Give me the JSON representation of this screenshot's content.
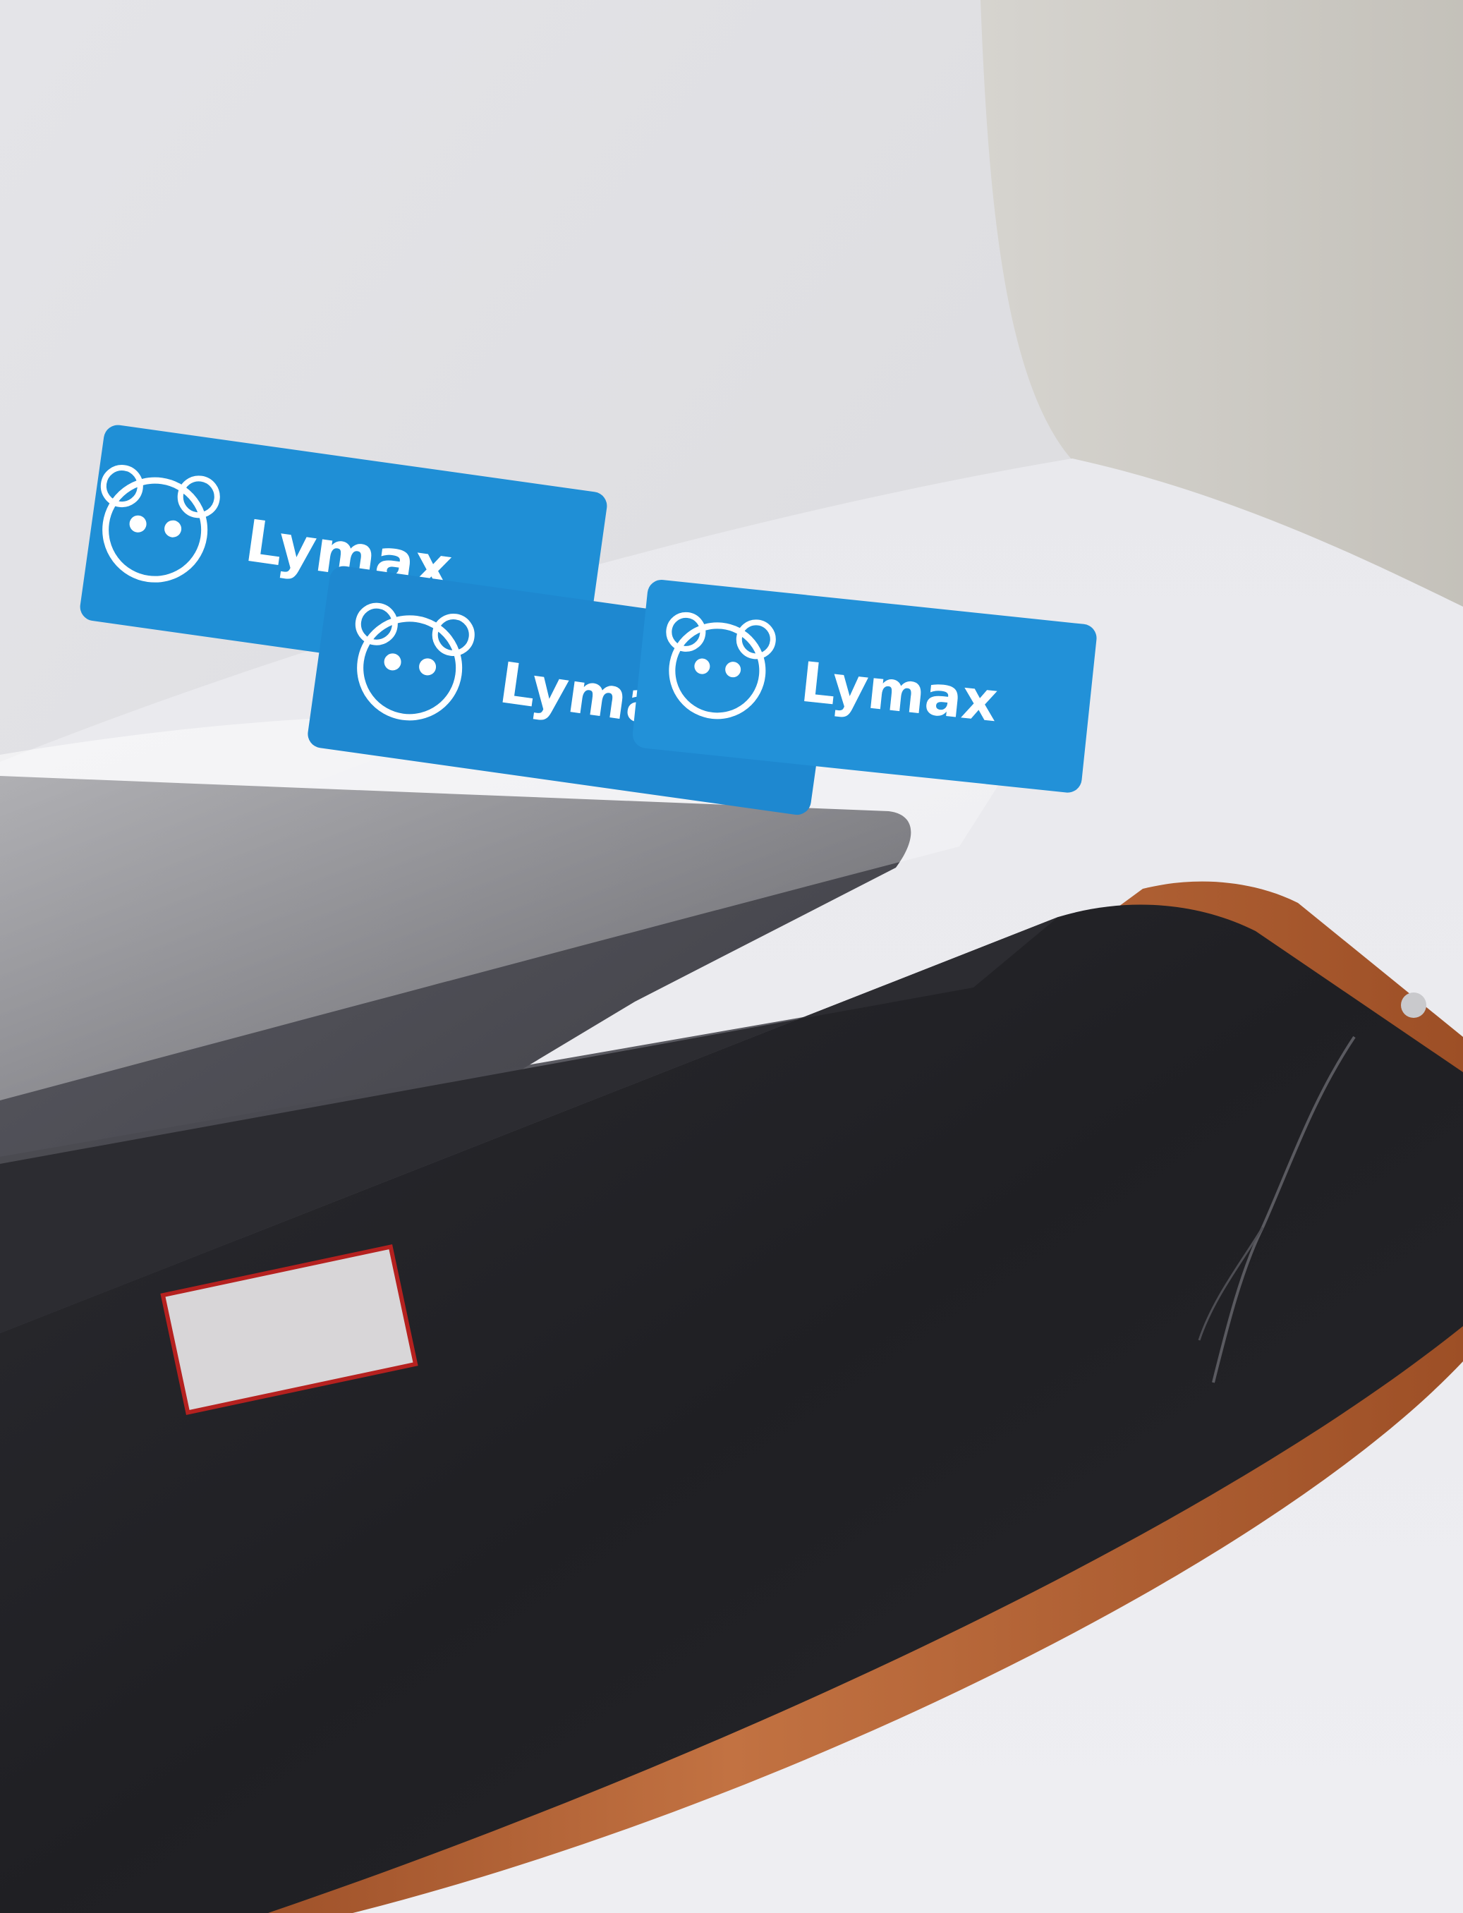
{
  "scene": {
    "subject": "Smartphone with cracked screen beside a screen-protector film with blue peel tabs",
    "colors": {
      "wall": "#dcdcdc",
      "wall_shadow": "#c9c6c0",
      "table": "#ebebef",
      "film_dark": "#3d3d44",
      "phone_screen": "#202024",
      "phone_case": "#b05e30",
      "tab_blue": "#1f8fd6"
    }
  },
  "tabs": [
    {
      "brand": "Lymax",
      "icon": "panda-icon"
    },
    {
      "brand": "Lymax",
      "icon": "panda-icon"
    },
    {
      "brand": "Lymax",
      "icon": "panda-icon"
    }
  ]
}
